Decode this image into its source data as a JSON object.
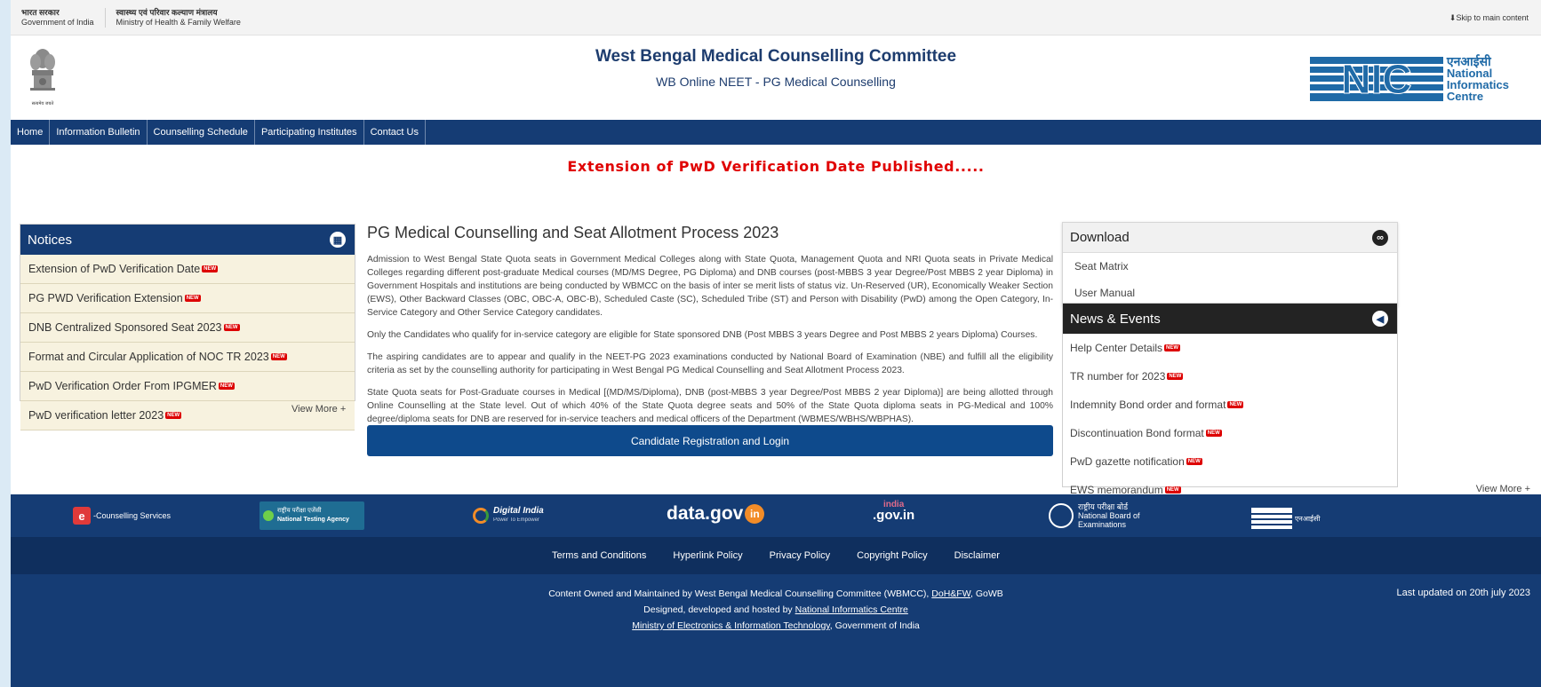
{
  "govbar": {
    "india_hi": "भारत सरकार",
    "india_en": "Government of India",
    "ministry_hi": "स्वास्थ्य एवं परिवार कल्याण मंत्रालय",
    "ministry_en": "Ministry of Health & Family Welfare",
    "skip": "⬇Skip to main content"
  },
  "header": {
    "title": "West Bengal Medical Counselling Committee",
    "subtitle": "WB Online NEET - PG Medical Counselling",
    "emblem_caption": "सत्यमेव जयते",
    "nic_hindi": "एनआईसी",
    "nic_l1": "National",
    "nic_l2": "Informatics",
    "nic_l3": "Centre"
  },
  "nav": {
    "items": [
      "Home",
      "Information Bulletin",
      "Counselling Schedule",
      "Participating Institutes",
      "Contact Us"
    ]
  },
  "announcement": "Extension of PwD Verification Date Published.....",
  "notices": {
    "title": "Notices",
    "items": [
      "Extension of PwD Verification Date",
      "PG PWD Verification Extension",
      "DNB Centralized Sponsored Seat 2023",
      "Format and Circular Application of NOC TR 2023",
      "PwD Verification Order From IPGMER",
      "PwD verification letter 2023"
    ],
    "new_badge": "NEW",
    "view_more": "View More +"
  },
  "main": {
    "title": "PG Medical Counselling and Seat Allotment Process 2023",
    "p1": "Admission to West Bengal State Quota seats in Government Medical Colleges along with State Quota, Management Quota and NRI Quota seats in Private Medical Colleges regarding different post-graduate Medical courses (MD/MS Degree, PG Diploma) and DNB courses (post-MBBS 3 year Degree/Post MBBS 2 year Diploma) in Government Hospitals and institutions are being conducted by WBMCC on the basis of inter se merit lists of status viz. Un-Reserved (UR), Economically Weaker Section (EWS), Other Backward Classes (OBC, OBC-A, OBC-B), Scheduled Caste (SC), Scheduled Tribe (ST) and Person with Disability (PwD) among the Open Category, In-Service Category and Other Service Category candidates.",
    "p2": "Only the Candidates who qualify for in-service category are eligible for State sponsored DNB (Post MBBS 3 years Degree and Post MBBS 2 years Diploma) Courses.",
    "p3": "The aspiring candidates are to appear and qualify in the NEET-PG 2023 examinations conducted by National Board of Examination (NBE) and fulfill all the eligibility criteria as set by the counselling authority for participating in West Bengal PG Medical Counselling and Seat Allotment Process 2023.",
    "p4": "State Quota seats for Post-Graduate courses in Medical [(MD/MS/Diploma), DNB (post-MBBS 3 year Degree/Post MBBS 2 year Diploma)] are being allotted through Online Counselling at the State level. Out of which 40% of the State Quota degree seats and 50% of the State Quota diploma seats in PG-Medical and 100% degree/diploma seats for DNB are reserved for in-service teachers and medical officers of the Department (WBMES/WBHS/WBPHAS).",
    "register_button": "Candidate Registration and Login"
  },
  "download": {
    "title": "Download",
    "items": [
      "Seat Matrix",
      "User Manual"
    ]
  },
  "news": {
    "title": "News & Events",
    "items": [
      "Help Center Details",
      "TR number for 2023",
      "Indemnity Bond order and format",
      "Discontinuation Bond format",
      "PwD gazette notification",
      "EWS memorandum"
    ],
    "view_more": "View More +"
  },
  "footer_logos": {
    "ecounselling": "-Counselling Services",
    "nta_hi": "राष्ट्रीय परीक्षा एजेंसी",
    "nta_en": "National Testing Agency",
    "digital_india": "Digital India",
    "digital_india_tag": "Power To Empower",
    "datagov": "data.gov",
    "datagov_in": "in",
    "indiagov_top": "india",
    "indiagov": ".gov.in",
    "nbe_hi": "राष्ट्रीय परीक्षा बोर्ड",
    "nbe_l1": "National Board of",
    "nbe_l2": "Examinations",
    "nic_hi": "एनआईसी"
  },
  "footer_links": [
    "Terms and Conditions",
    "Hyperlink Policy",
    "Privacy Policy",
    "Copyright Policy",
    "Disclaimer"
  ],
  "credits": {
    "l1_pre": "Content Owned and Maintained by West Bengal Medical Counselling Committee (WBMCC),",
    "l1_link": "DoH&FW",
    "l1_post": ", GoWB",
    "l2_pre": "Designed, developed and hosted by",
    "l2_link": "National Informatics Centre",
    "l3_link": "Ministry of Electronics & Information Technology",
    "l3_post": ", Government of India",
    "last_updated": "Last updated on 20th july 2023"
  },
  "colors": {
    "nav_blue": "#153c74",
    "alert_red": "#e00000",
    "notice_bg": "#f7f2df",
    "news_head": "#232323",
    "button_blue": "#0e4a8c"
  }
}
